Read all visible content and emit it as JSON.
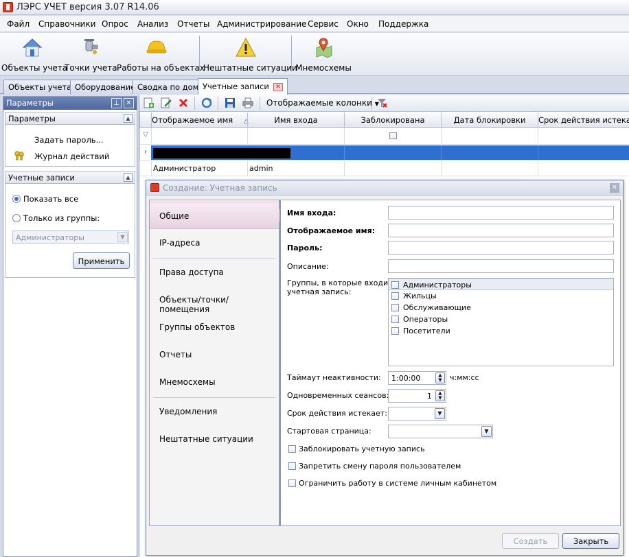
{
  "window": {
    "title": "ЛЭРС УЧЕТ версия 3.07 R14.06"
  },
  "menu": [
    "Файл",
    "Справочники",
    "Опрос",
    "Анализ",
    "Отчеты",
    "Администрирование",
    "Сервис",
    "Окно",
    "Поддержка"
  ],
  "toolbar": {
    "items": [
      {
        "label": "Объекты учета",
        "icon": "house-icon"
      },
      {
        "label": "Точки учета",
        "icon": "faucet-icon"
      },
      {
        "label": "Работы на объектах",
        "icon": "hardhat-icon"
      },
      {
        "label": "Нештатные ситуации",
        "icon": "warning-icon"
      },
      {
        "label": "Мнемосхемы",
        "icon": "map-pin-icon"
      }
    ]
  },
  "doc_tabs": [
    {
      "label": "Объекты учета"
    },
    {
      "label": "Оборудование"
    },
    {
      "label": "Сводка по дому"
    },
    {
      "label": "Учетные записи",
      "active": true
    }
  ],
  "left_panel": {
    "title": "Параметры",
    "params_group": {
      "title": "Параметры",
      "set_password": "Задать пароль...",
      "action_log": "Журнал действий"
    },
    "accounts_group": {
      "title": "Учетные записи",
      "show_all": "Показать все",
      "only_group": "Только из группы:",
      "group_select": "Администраторы",
      "apply": "Применить"
    }
  },
  "grid": {
    "toolbar": {
      "columns_label": "Отображаемые колонки"
    },
    "columns": [
      "Отображаемое имя",
      "Имя входа",
      "Заблокирована",
      "Дата блокировки",
      "Срок действия истекает"
    ],
    "rows": [
      {
        "display_name": "",
        "login": ""
      },
      {
        "display_name": "Администратор",
        "login": "admin"
      }
    ]
  },
  "dialog": {
    "title": "Создание:  Учетная запись",
    "nav": [
      "Общие",
      "IP-адреса",
      "Права доступа",
      "Объекты/точки/помещения",
      "Группы объектов",
      "Отчеты",
      "Мнемосхемы",
      "Уведомления",
      "Нештатные ситуации"
    ],
    "form": {
      "login_label": "Имя входа:",
      "display_name_label": "Отображаемое имя:",
      "password_label": "Пароль:",
      "description_label": "Описание:",
      "groups_label_1": "Группы, в которые входит",
      "groups_label_2": "учетная запись:",
      "groups": [
        "Администраторы",
        "Жильцы",
        "Обслуживающие",
        "Операторы",
        "Посетители"
      ],
      "timeout_label": "Таймаут неактивности:",
      "timeout_value": "1:00:00",
      "timeout_unit": "ч:мм:сс",
      "sessions_label": "Одновременных сеансов:",
      "sessions_value": "1",
      "expires_label": "Срок действия истекает:",
      "start_page_label": "Стартовая страница:",
      "lock_account": "Заблокировать учетную запись",
      "forbid_password_change": "Запретить смену пароля пользователем",
      "limit_cabinet": "Ограничить работу в системе личным кабинетом"
    },
    "buttons": {
      "create": "Создать",
      "close": "Закрыть"
    }
  }
}
